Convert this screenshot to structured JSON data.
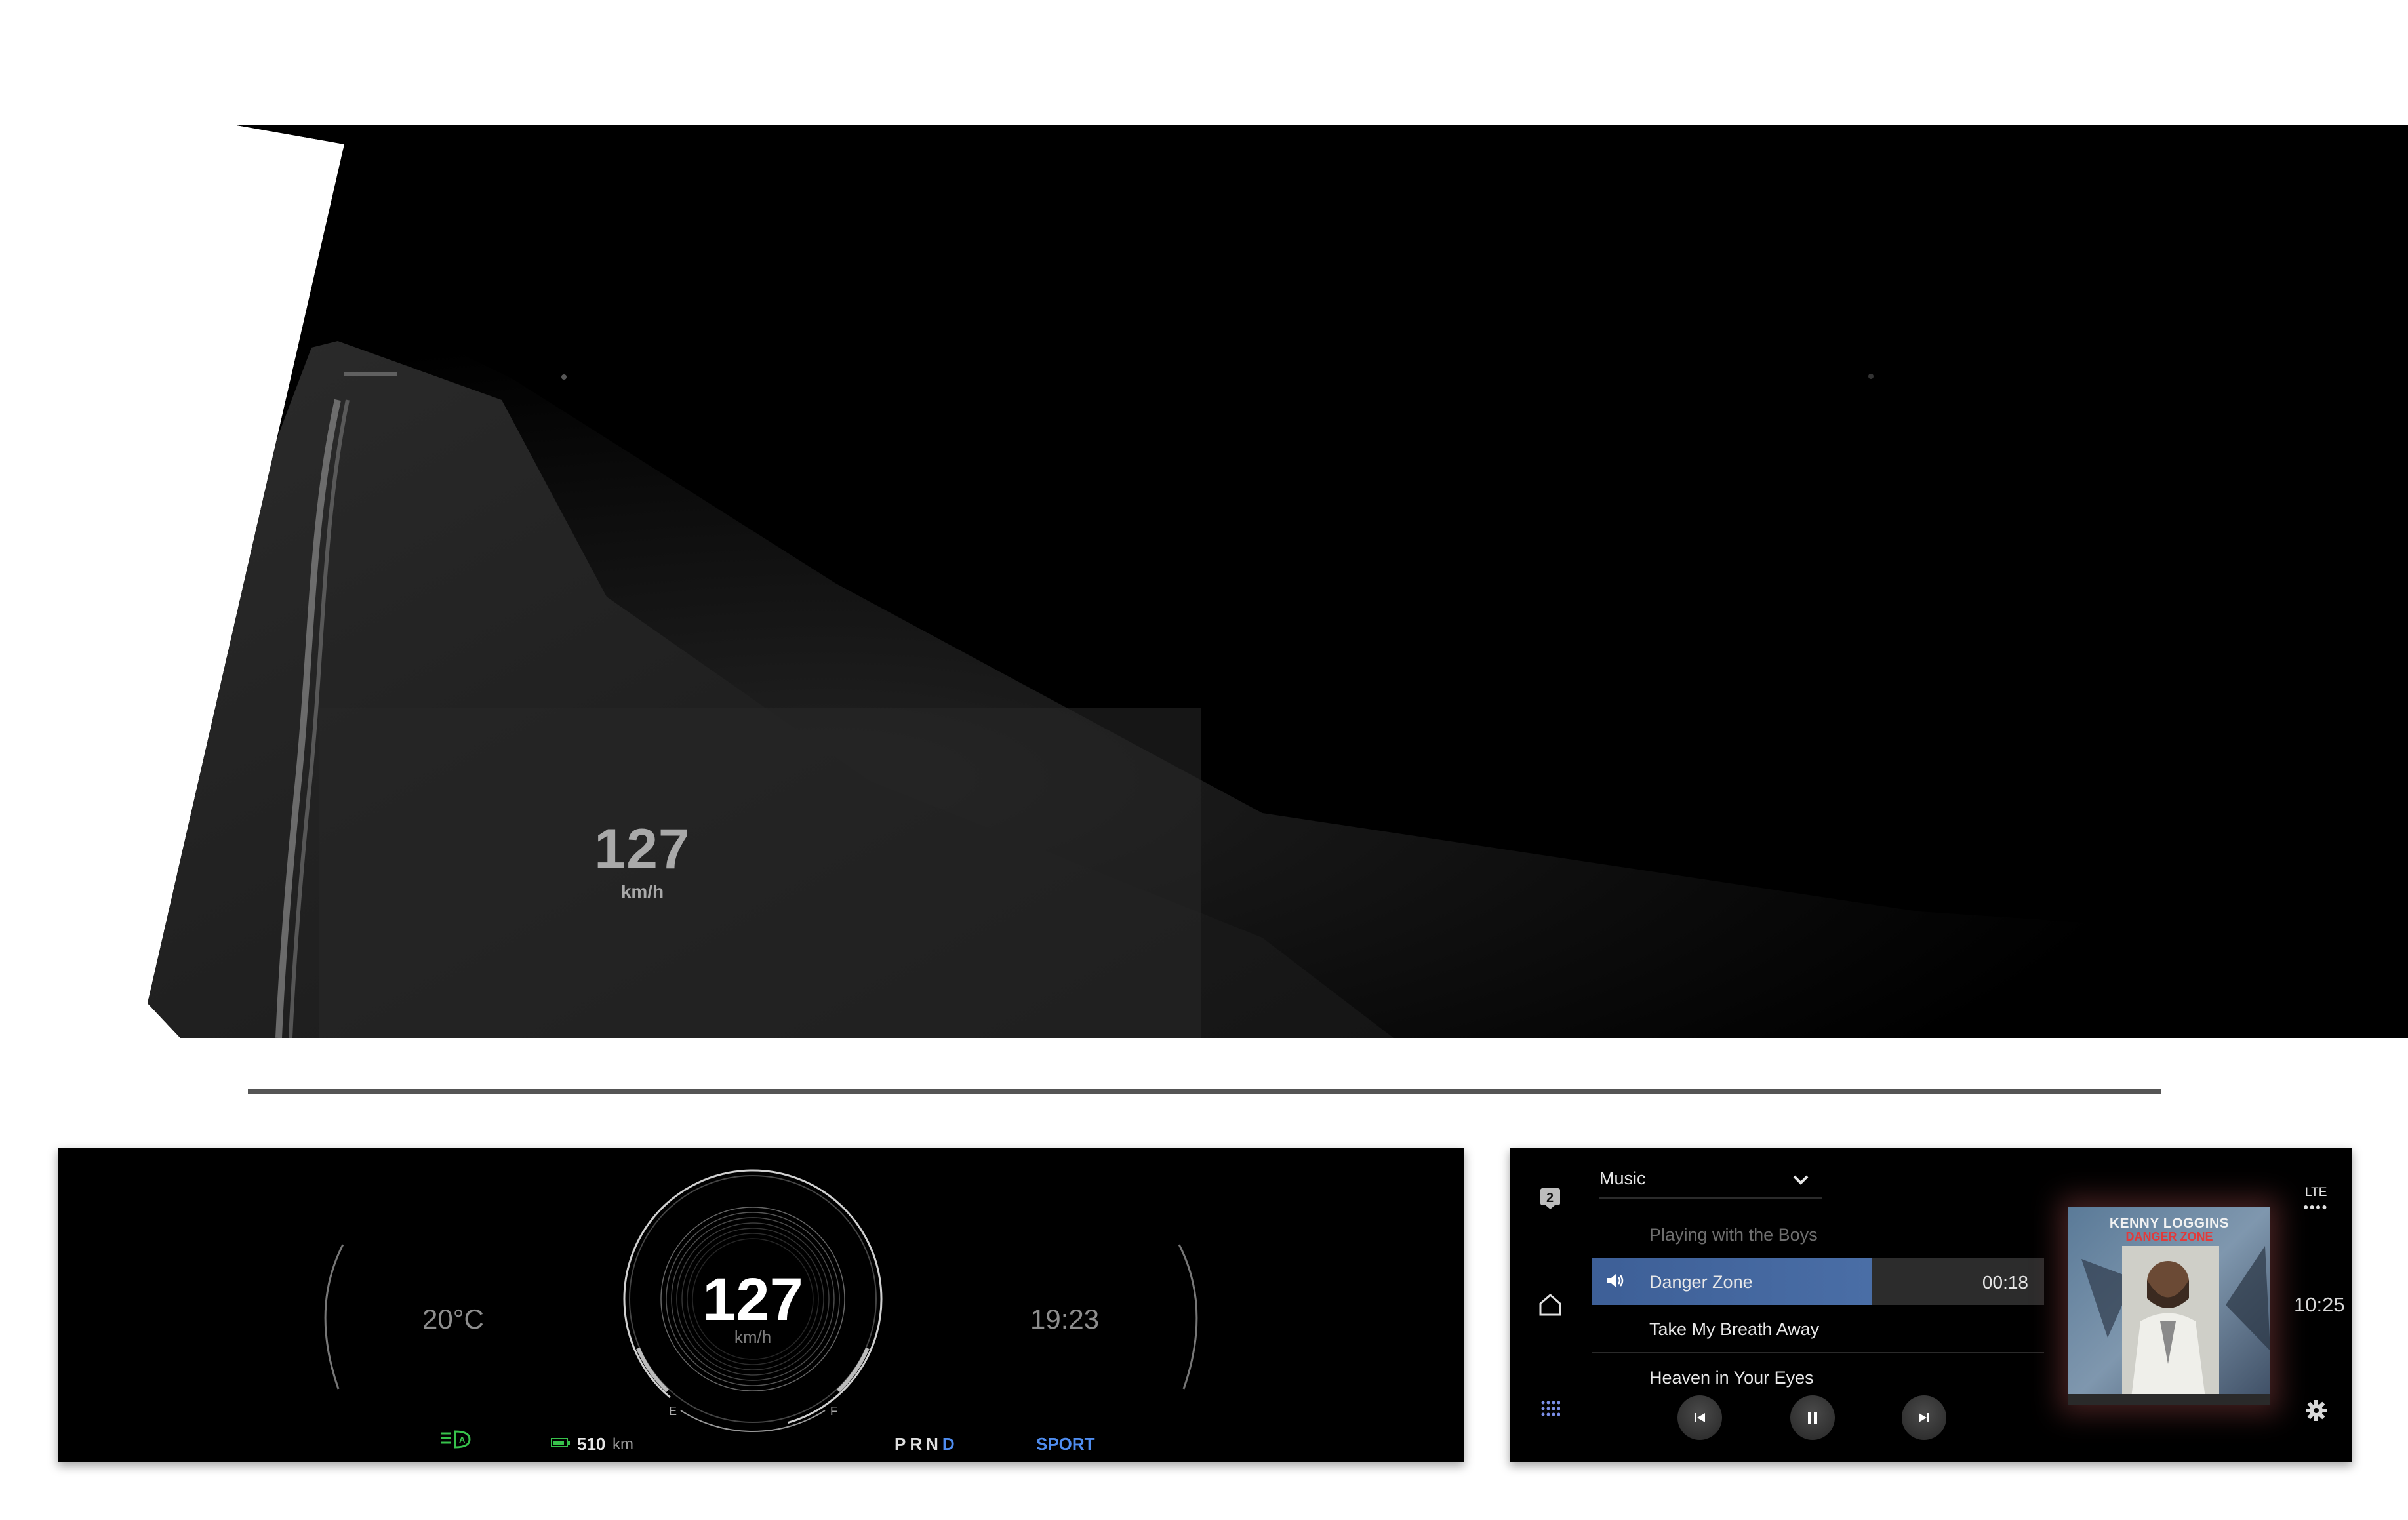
{
  "hud": {
    "speed": "127",
    "unit": "km/h"
  },
  "cluster": {
    "temperature": "20°C",
    "clock": "19:23",
    "speed": "127",
    "speed_unit": "km/h",
    "fuel_empty_label": "E",
    "fuel_full_label": "F",
    "range_value": "510",
    "range_unit": "km",
    "gears": [
      "P",
      "R",
      "N",
      "D"
    ],
    "active_gear": "D",
    "drive_mode": "SPORT",
    "colors": {
      "accent": "#4f8df0",
      "eco_green": "#37c24b"
    },
    "icons": {
      "lights": "auto-headlight-icon",
      "battery": "battery-icon"
    }
  },
  "infotainment": {
    "source": "Music",
    "tracks": [
      {
        "title": "Playing with the Boys"
      },
      {
        "title": "Danger Zone",
        "time": "00:18",
        "playing": true
      },
      {
        "title": "Take My Breath Away"
      },
      {
        "title": "Heaven in Your Eyes"
      }
    ],
    "playback_progress": 0.62,
    "album": {
      "artist": "KENNY LOGGINS",
      "title": "DANGER ZONE"
    },
    "status": {
      "network": "LTE",
      "time": "10:25"
    },
    "nav_icons": [
      "profile-2-icon",
      "home-icon",
      "apps-grid-icon"
    ],
    "controls": [
      "previous-icon",
      "pause-icon",
      "next-icon"
    ],
    "colors": {
      "highlight": "#4a6ea6"
    }
  }
}
